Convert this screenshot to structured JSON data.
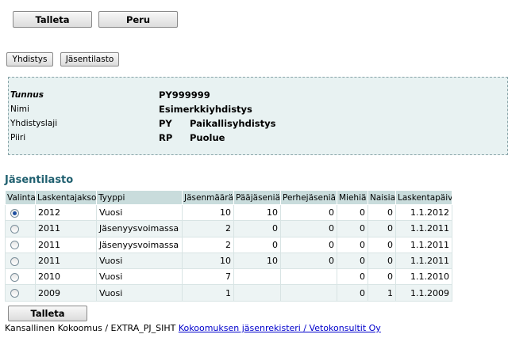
{
  "toolbar": {
    "save_label": "Talleta",
    "cancel_label": "Peru"
  },
  "tabs": {
    "association_label": "Yhdistys",
    "member_stats_label": "Jäsentilasto"
  },
  "info": {
    "id_label": "Tunnus",
    "id_value": "PY999999",
    "name_label": "Nimi",
    "name_value": "Esimerkkiyhdistys",
    "type_label": "Yhdistyslaji",
    "type_code": "PY",
    "type_name": "Paikallisyhdistys",
    "district_label": "Piiri",
    "district_code": "RP",
    "district_name": "Puolue"
  },
  "section_title": "Jäsentilasto",
  "table": {
    "columns": [
      "Valinta",
      "Laskentajakso",
      "Tyyppi",
      "Jäsenmäärä",
      "Pääjäseniä",
      "Perhejäseniä",
      "Miehiä",
      "Naisia",
      "Laskentapäivä"
    ],
    "rows": [
      {
        "selected": true,
        "period": "2012",
        "type": "Vuosi",
        "members": "10",
        "main": "10",
        "family": "0",
        "men": "0",
        "women": "0",
        "date": "1.1.2012"
      },
      {
        "selected": false,
        "period": "2011",
        "type": "Jäsenyysvoimassa",
        "members": "2",
        "main": "0",
        "family": "0",
        "men": "0",
        "women": "0",
        "date": "1.1.2011"
      },
      {
        "selected": false,
        "period": "2011",
        "type": "Jäsenyysvoimassa",
        "members": "2",
        "main": "0",
        "family": "0",
        "men": "0",
        "women": "0",
        "date": "1.1.2011"
      },
      {
        "selected": false,
        "period": "2011",
        "type": "Vuosi",
        "members": "10",
        "main": "10",
        "family": "0",
        "men": "0",
        "women": "0",
        "date": "1.1.2011"
      },
      {
        "selected": false,
        "period": "2010",
        "type": "Vuosi",
        "members": "7",
        "main": "",
        "family": "",
        "men": "0",
        "women": "0",
        "date": "1.1.2010"
      },
      {
        "selected": false,
        "period": "2009",
        "type": "Vuosi",
        "members": "1",
        "main": "",
        "family": "",
        "men": "0",
        "women": "1",
        "date": "1.1.2009"
      }
    ]
  },
  "bottom_save_label": "Talleta",
  "footer": {
    "text": "Kansallinen Kokoomus / EXTRA_PJ_SIHT",
    "link_text": "Kokoomuksen jäsenrekisteri / Vetokonsultit Oy"
  }
}
